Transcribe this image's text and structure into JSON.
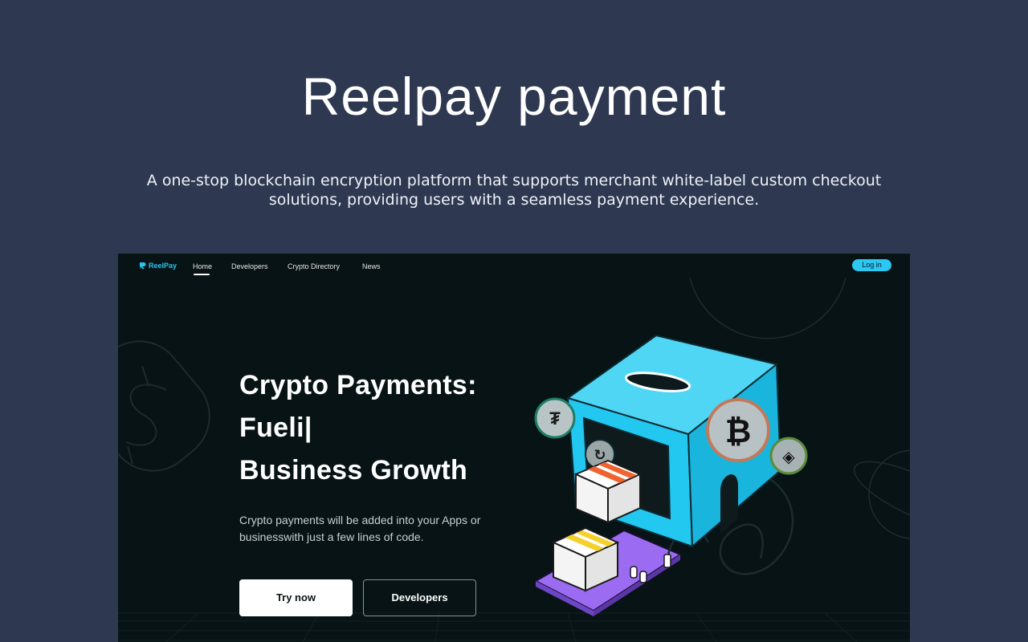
{
  "page": {
    "title": "Reelpay payment",
    "subtitle": "A one-stop blockchain encryption platform that supports merchant white-label custom checkout solutions, providing users with a seamless payment experience."
  },
  "preview": {
    "logo_text": "ReelPay",
    "nav": [
      "Home",
      "Developers",
      "Crypto Directory",
      "News"
    ],
    "active_nav": "Home",
    "login_label": "Log in",
    "hero": {
      "line1": "Crypto Payments:",
      "line2": "Fueli|",
      "line3": "Business Growth",
      "description": "Crypto payments will be added into your Apps or businesswith just a few lines of code."
    },
    "buttons": {
      "try": "Try now",
      "developers": "Developers"
    },
    "icons": [
      "dollar-sign-icon",
      "tether-coin-icon",
      "bitcoin-coin-icon",
      "binance-coin-icon",
      "swap-coin-icon",
      "planet-icon"
    ],
    "colors": {
      "accent": "#2cc7f2",
      "background": "#071314",
      "page_bg": "#2e3951",
      "box_orange": "#f0622e",
      "box_yellow": "#f5cf2a",
      "base_purple": "#9b6cf2"
    }
  }
}
